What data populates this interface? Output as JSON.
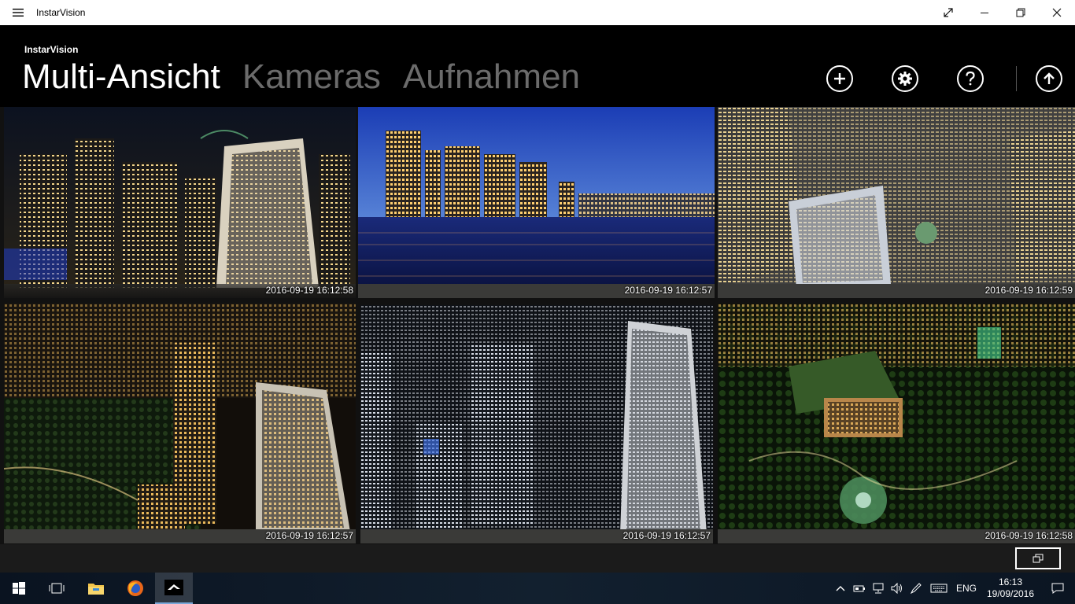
{
  "window": {
    "title": "InstarVision",
    "menu_icon": "hamburger-icon",
    "controls": {
      "fullscreen_icon": "expand-icon",
      "minimize_icon": "minimize-icon",
      "restore_icon": "restore-icon",
      "close_icon": "close-icon"
    }
  },
  "header": {
    "app_name": "InstarVision",
    "tabs": [
      {
        "label": "Multi-Ansicht",
        "active": true
      },
      {
        "label": "Kameras",
        "active": false
      },
      {
        "label": "Aufnahmen",
        "active": false
      }
    ],
    "buttons": {
      "add_icon": "plus-icon",
      "settings_icon": "gear-icon",
      "help_icon": "question-icon",
      "upload_icon": "arrow-up-icon"
    }
  },
  "cameras": [
    {
      "timestamp": "2016-09-19 16:12:58",
      "scene": "night-skyline-harbour"
    },
    {
      "timestamp": "2016-09-19 16:12:57",
      "scene": "harbour-dusk-water"
    },
    {
      "timestamp": "2016-09-19 16:12:59",
      "scene": "aerial-towers"
    },
    {
      "timestamp": "2016-09-19 16:12:57",
      "scene": "night-park-towers"
    },
    {
      "timestamp": "2016-09-19 16:12:57",
      "scene": "dense-cbd-night"
    },
    {
      "timestamp": "2016-09-19 16:12:58",
      "scene": "park-cathedral-night"
    }
  ],
  "appbar": {
    "layout_icon": "windows-overlap-icon"
  },
  "taskbar": {
    "apps": [
      "start-icon",
      "task-view-icon",
      "file-explorer-icon",
      "firefox-icon",
      "instarvision-icon"
    ],
    "tray": {
      "language": "ENG",
      "time": "16:13",
      "date": "19/09/2016"
    }
  },
  "colors": {
    "accent": "#7aa7d8",
    "inactive_tab": "#6b6b6b"
  }
}
